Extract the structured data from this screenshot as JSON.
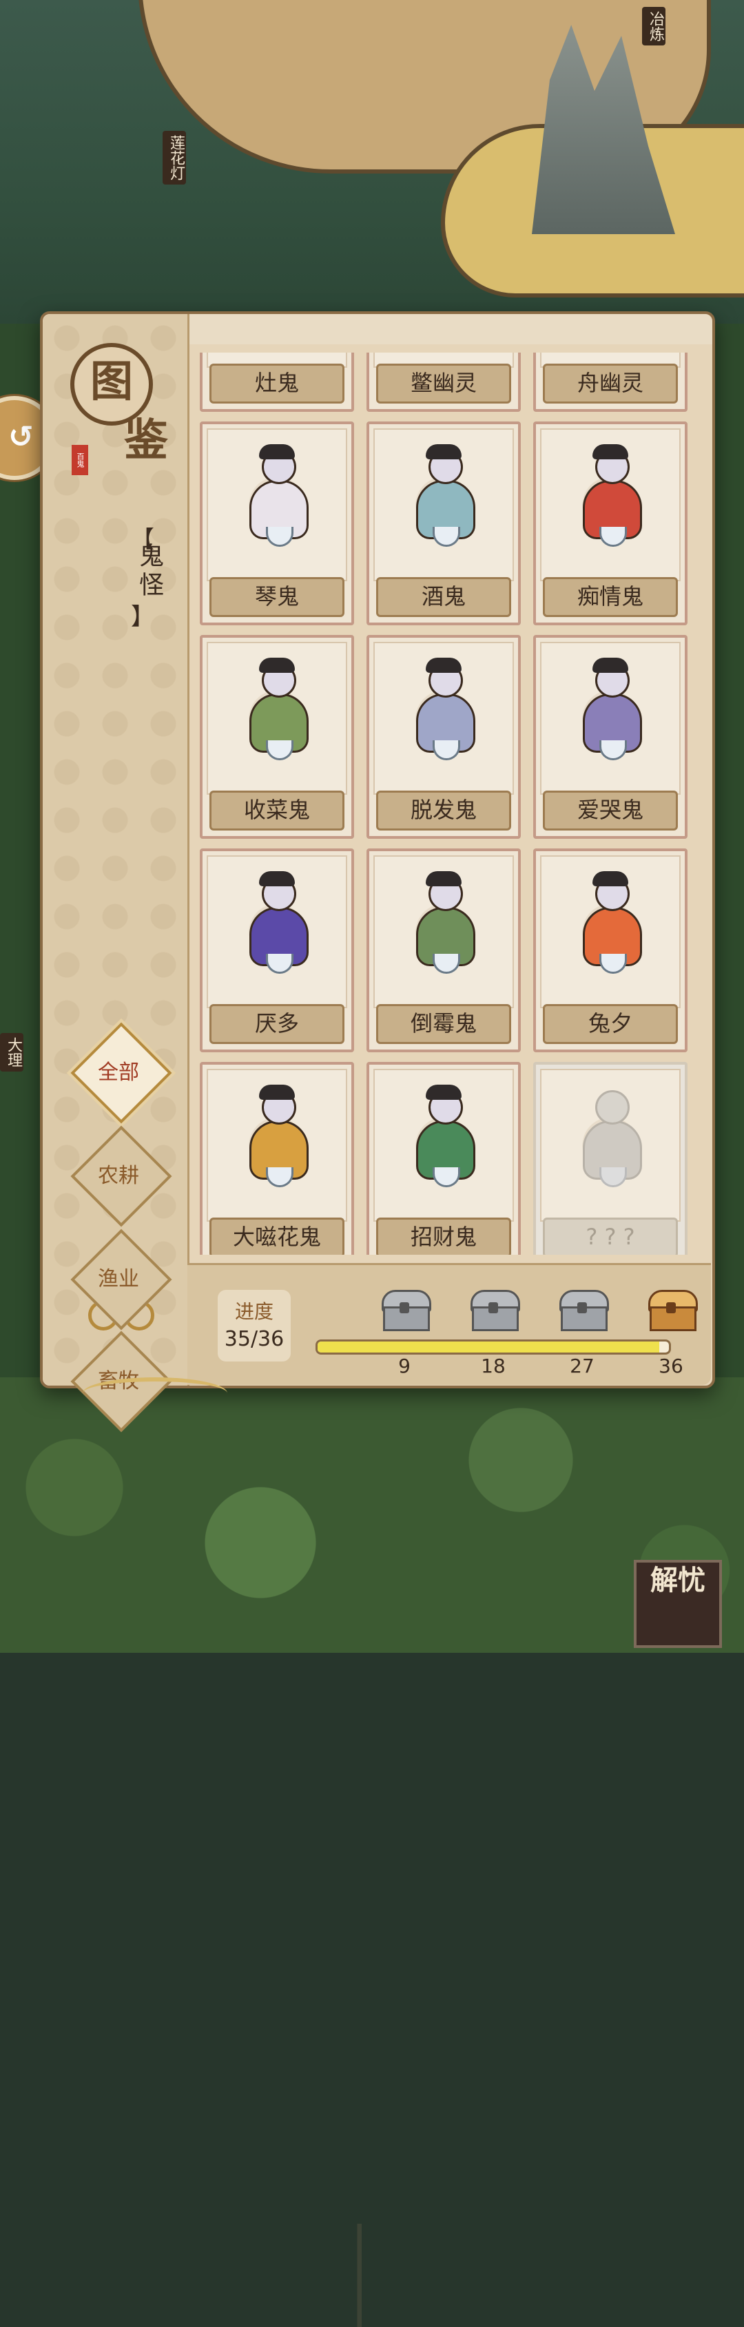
{
  "map": {
    "signs": [
      "冶炼",
      "莲花灯",
      "大理"
    ]
  },
  "panel": {
    "title_top": "图",
    "title_bottom": "鉴",
    "mini_seal": "百鬼",
    "category_open": "【",
    "category": "鬼怪",
    "category_close": "】"
  },
  "tabs": [
    {
      "label": "全部",
      "active": true
    },
    {
      "label": "农耕",
      "active": false
    },
    {
      "label": "渔业",
      "active": false
    },
    {
      "label": "畜牧",
      "active": false
    }
  ],
  "cards": [
    {
      "name": "灶鬼",
      "locked": false
    },
    {
      "name": "鳖幽灵",
      "locked": false
    },
    {
      "name": "舟幽灵",
      "locked": false
    },
    {
      "name": "琴鬼",
      "locked": false,
      "color": "#e9e3ea"
    },
    {
      "name": "酒鬼",
      "locked": false,
      "color": "#8fb8c0"
    },
    {
      "name": "痴情鬼",
      "locked": false,
      "color": "#d04a3a"
    },
    {
      "name": "收菜鬼",
      "locked": false,
      "color": "#7d9a5a"
    },
    {
      "name": "脱发鬼",
      "locked": false,
      "color": "#9fa6c8"
    },
    {
      "name": "爱哭鬼",
      "locked": false,
      "color": "#8a7fb8"
    },
    {
      "name": "厌多",
      "locked": false,
      "color": "#5b4aa8"
    },
    {
      "name": "倒霉鬼",
      "locked": false,
      "color": "#6f8f5a"
    },
    {
      "name": "兔夕",
      "locked": false,
      "color": "#e46a3a"
    },
    {
      "name": "大嗞花鬼",
      "locked": false,
      "color": "#d8a040"
    },
    {
      "name": "招财鬼",
      "locked": false,
      "color": "#4a8a5a"
    },
    {
      "name": "? ? ?",
      "locked": true,
      "color": "#cfcac2"
    }
  ],
  "progress": {
    "label": "进度",
    "text": "35/36",
    "value": 35,
    "max": 36,
    "milestones": [
      {
        "label": "9",
        "value": 9,
        "reward": "chest-icon"
      },
      {
        "label": "18",
        "value": 18,
        "reward": "chest-icon"
      },
      {
        "label": "27",
        "value": 27,
        "reward": "chest-icon"
      },
      {
        "label": "36",
        "value": 36,
        "reward": "gold-chest-icon"
      }
    ]
  },
  "corner_seal": "解忧",
  "colors": {
    "accent": "#b58a3c",
    "progress_fill": "#efe04d",
    "panel_bg": "#e6d5b9"
  }
}
